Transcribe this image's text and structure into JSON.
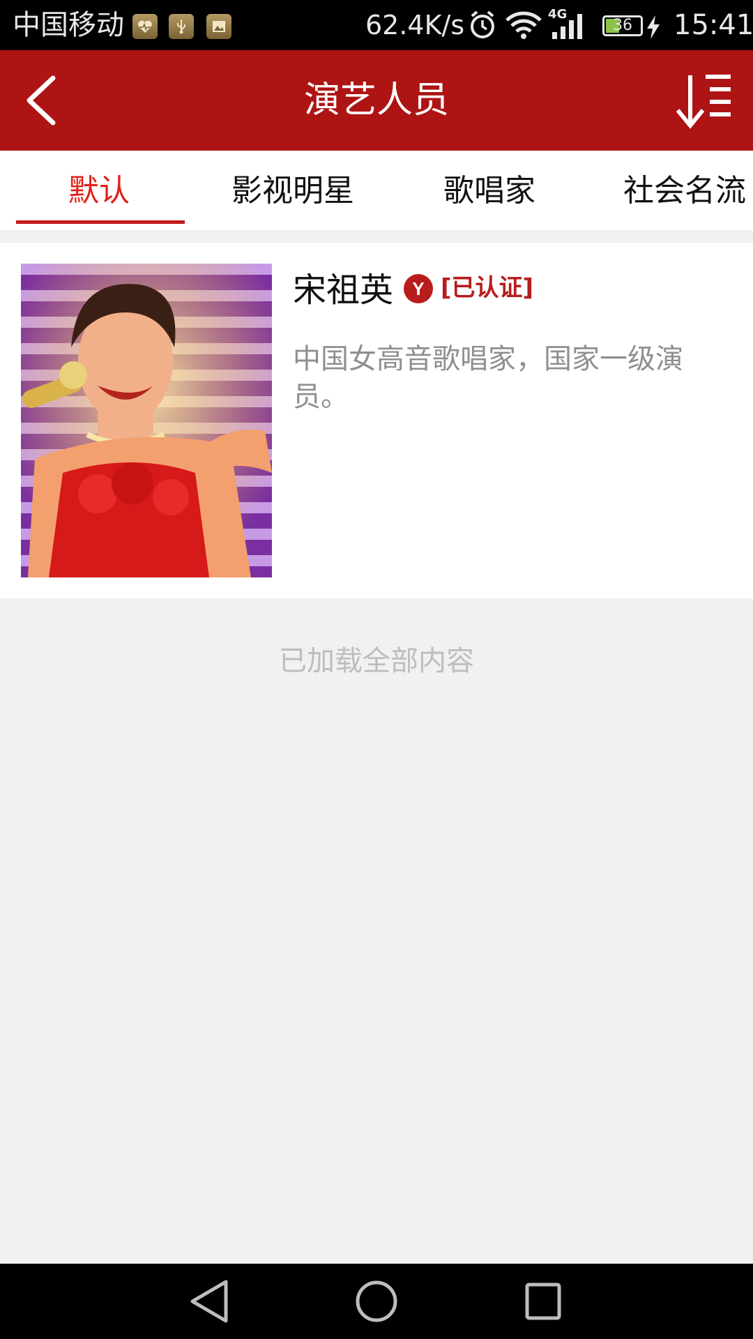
{
  "status_bar": {
    "carrier": "中国移动",
    "net_speed": "62.4K/s",
    "network_type": "4G",
    "battery_level": "36",
    "time": "15:41"
  },
  "app_bar": {
    "title": "演艺人员",
    "back_icon": "chevron-left-icon",
    "sort_icon": "sort-list-icon"
  },
  "tabs": [
    {
      "label": "默认",
      "active": true
    },
    {
      "label": "影视明星",
      "active": false
    },
    {
      "label": "歌唱家",
      "active": false
    },
    {
      "label": "社会名流",
      "active": false
    }
  ],
  "list": [
    {
      "name": "宋祖英",
      "badge_letter": "Y",
      "verified_label": "[已认证]",
      "description": "中国女高音歌唱家，国家一级演员。"
    }
  ],
  "footer_text": "已加载全部内容",
  "colors": {
    "primary": "#ae1414",
    "active_tab": "#e0201c",
    "verified": "#b81c1c"
  }
}
